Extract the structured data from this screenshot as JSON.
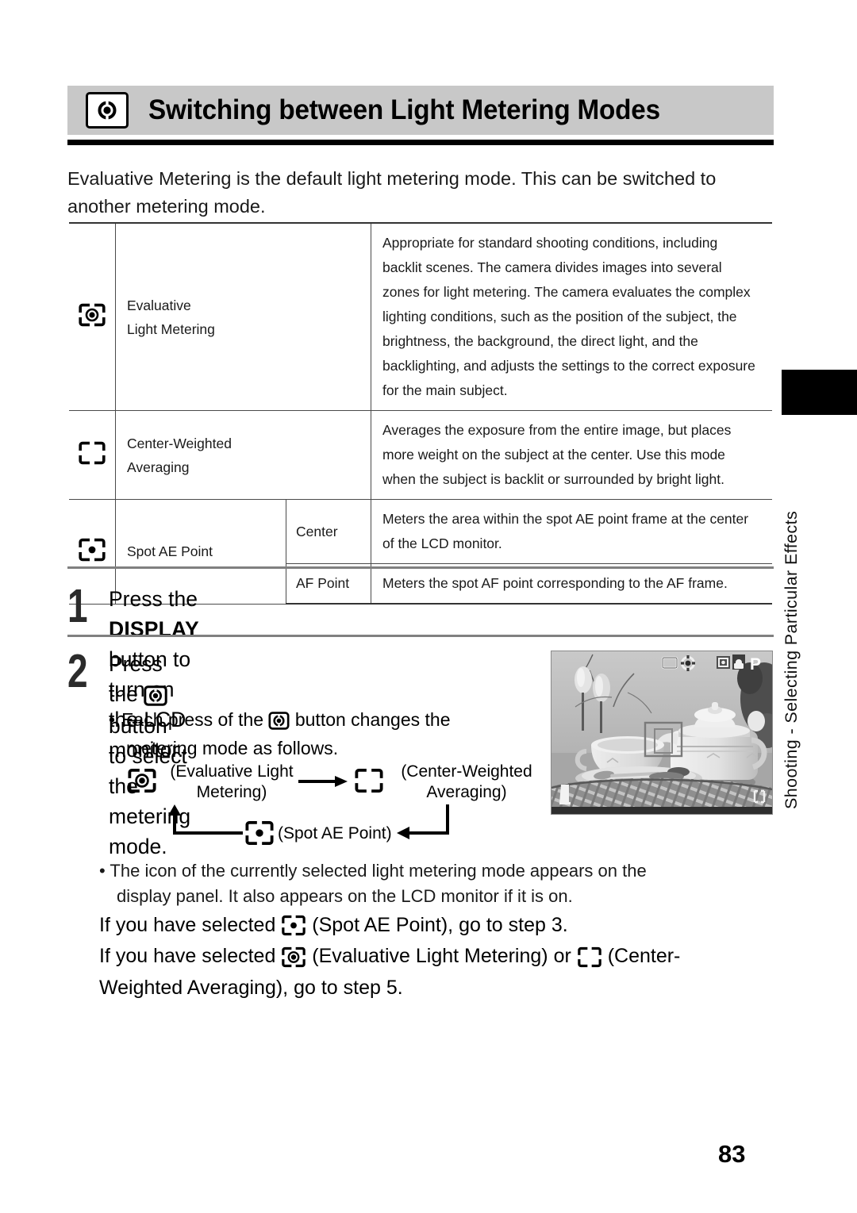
{
  "header": {
    "title": "Switching between Light Metering Modes",
    "icon": "metering-mode-icon"
  },
  "intro": "Evaluative Metering is the default light metering mode. This can be switched to another metering mode.",
  "table": {
    "rows": [
      {
        "icon": "evaluative-light-metering-icon",
        "name": "Evaluative\nLight Metering",
        "name_line1": "Evaluative",
        "name_line2": "Light Metering",
        "sub": "",
        "desc": "Appropriate for standard shooting conditions, including backlit scenes. The camera divides images into several zones for light metering. The camera evaluates the complex lighting conditions, such as the position of the subject, the brightness, the background, the direct light, and the backlighting, and adjusts the settings to the correct exposure for the main subject."
      },
      {
        "icon": "center-weighted-averaging-icon",
        "name_line1": "Center-Weighted",
        "name_line2": "Averaging",
        "sub": "",
        "desc": "Averages the exposure from the entire image, but places more weight on the subject at the center. Use this mode when the subject is backlit or surrounded by bright light."
      },
      {
        "icon": "spot-ae-point-icon",
        "name_line1": "Spot AE Point",
        "name_line2": "",
        "sub": "Center",
        "desc": "Meters the area within the spot AE point frame at the center of the LCD monitor."
      },
      {
        "icon": "",
        "name_line1": "",
        "name_line2": "",
        "sub": "AF Point",
        "desc": "Meters the spot AF point corresponding to the AF frame."
      }
    ]
  },
  "steps": [
    {
      "number": "1",
      "text_before": "Press the ",
      "bold": "DISPLAY",
      "text_after": " button to turn on the LCD monitor."
    },
    {
      "number": "2",
      "text_before": "Press the ",
      "icon": "metering-mode-button-icon",
      "text_after": " button to select the",
      "text_line2": "metering mode."
    }
  ],
  "bullet_each_press": {
    "before": "Each press of the ",
    "icon": "metering-mode-button-icon",
    "after": " button changes the",
    "line2": "metering mode as follows."
  },
  "cycle": {
    "items": [
      {
        "icon": "evaluative-light-metering-icon",
        "label_line1": "(Evaluative Light",
        "label_line2": "Metering)"
      },
      {
        "icon": "center-weighted-averaging-icon",
        "label_line1": "(Center-Weighted",
        "label_line2": "Averaging)"
      },
      {
        "icon": "spot-ae-point-icon",
        "label_line1": "(Spot AE Point)",
        "label_line2": ""
      }
    ]
  },
  "photo": {
    "caption": "LCD monitor preview of tea set",
    "overlay_icons": [
      "lcd-frame-icon",
      "metering-mode-icon",
      "ae-lock-icon",
      "flash-icon",
      "program-mode-P"
    ],
    "overlay_mode_letter": "P"
  },
  "tail": {
    "bullet_line1": "The icon of the currently selected light metering mode appears on the",
    "bullet_line2": "display panel. It also appears on the LCD monitor if it is on.",
    "line3_a": "If you have selected ",
    "line3_icon": "spot-ae-point-icon",
    "line3_b": " (Spot AE Point), go to step 3.",
    "line4_a": "If you have selected ",
    "line4_icon1": "evaluative-light-metering-icon",
    "line4_b": " (Evaluative Light Metering) or ",
    "line4_icon2": "center-weighted-averaging-icon",
    "line4_c": " (Center-",
    "line5": "Weighted Averaging), go to step 5."
  },
  "side_tab": {
    "label": "Shooting - Selecting Particular Effects"
  },
  "page_number": "83",
  "colors": {
    "banner_bg": "#c8c8c8",
    "rule": "#000000",
    "text": "#1a1a1a",
    "step_rule": "#808080",
    "tab": "#000000"
  }
}
